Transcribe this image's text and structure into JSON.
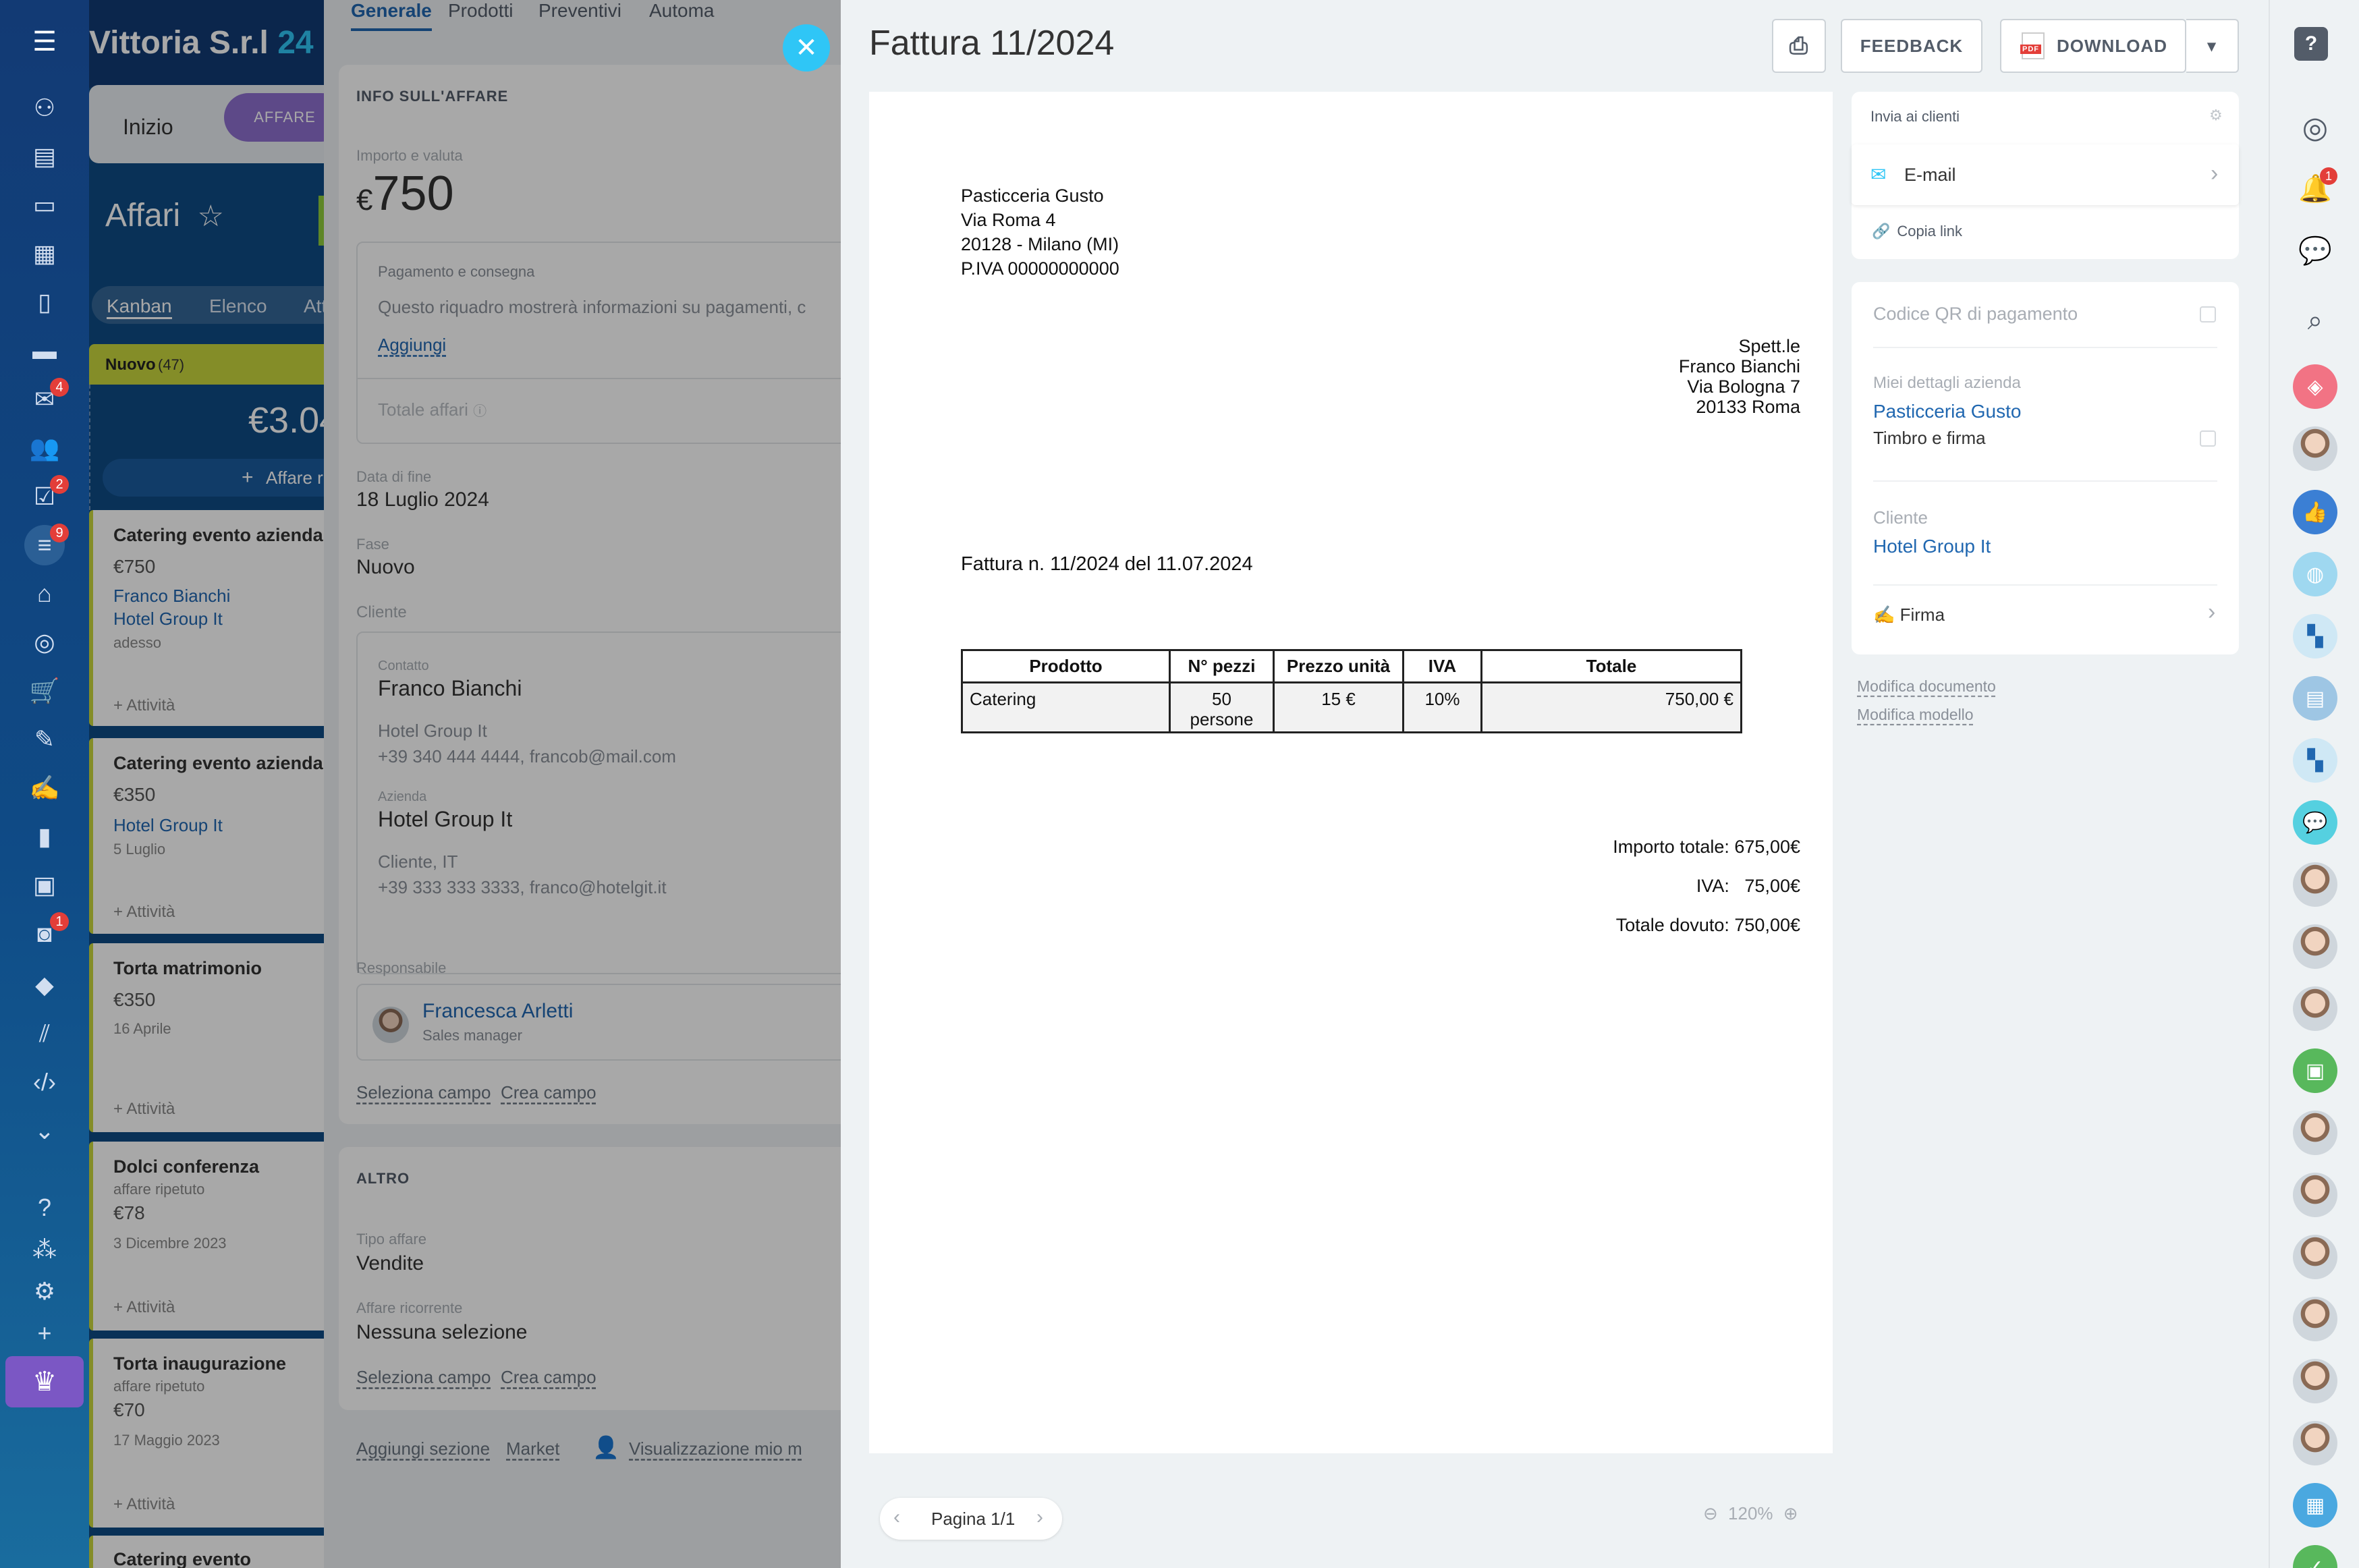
{
  "left_nav": {
    "badges": {
      "mail": "4",
      "tasks": "2",
      "filters": "9",
      "robots": "1"
    }
  },
  "crm": {
    "company_title": "Vittoria S.r.l",
    "company_suffix": "24",
    "stage_tabs": {
      "start": "Inizio",
      "deal_badge": "AFFARE"
    },
    "page_title": "Affari",
    "view_tabs": [
      "Kanban",
      "Elenco",
      "Att"
    ],
    "column": {
      "name": "Nuovo",
      "count": "(47)",
      "total": "€3.04",
      "add_button": "Affare r"
    },
    "deal_cards": [
      {
        "title": "Catering evento aziendale",
        "amount": "€750",
        "contact": "Franco Bianchi",
        "company": "Hotel Group It",
        "date": "adesso",
        "activity": "+ Attività"
      },
      {
        "title": "Catering evento aziendale",
        "amount": "€350",
        "contact": "",
        "company": "Hotel Group It",
        "date": "5 Luglio",
        "activity": "+ Attività"
      },
      {
        "title": "Torta matrimonio",
        "amount": "€350",
        "date": "16 Aprile",
        "activity": "+ Attività"
      },
      {
        "title": "Dolci conferenza",
        "subtitle": "affare ripetuto",
        "amount": "€78",
        "date": "3 Dicembre 2023",
        "activity": "+ Attività"
      },
      {
        "title": "Torta inaugurazione",
        "subtitle": "affare ripetuto",
        "amount": "€70",
        "date": "17 Maggio 2023",
        "activity": "+ Attività"
      },
      {
        "title": "Catering evento"
      }
    ],
    "deal_tabs": [
      "Generale",
      "Prodotti",
      "Preventivi",
      "Automa"
    ],
    "info_section": {
      "title": "INFO SULL'AFFARE",
      "amount_label": "Importo e valuta",
      "currency": "€",
      "amount": "750",
      "payment_label": "Pagamento e consegna",
      "payment_text": "Questo riquadro mostrerà informazioni su pagamenti, c",
      "add_link": "Aggiungi",
      "total_label": "Totale affari",
      "end_date_label": "Data di fine",
      "end_date": "18 Luglio 2024",
      "stage_label": "Fase",
      "stage": "Nuovo",
      "client_label": "Cliente",
      "contact_label": "Contatto",
      "contact_name": "Franco Bianchi",
      "contact_company": "Hotel Group It",
      "contact_details": "+39 340 444 4444, francob@mail.com",
      "company_label": "Azienda",
      "company_name": "Hotel Group It",
      "company_type": "Cliente, IT",
      "company_details": "+39 333 333 3333, franco@hotelgit.it",
      "responsible_label": "Responsabile",
      "responsible_name": "Francesca Arletti",
      "responsible_role": "Sales manager",
      "select_field": "Seleziona campo",
      "create_field": "Crea campo"
    },
    "other_section": {
      "title": "ALTRO",
      "type_label": "Tipo affare",
      "type_value": "Vendite",
      "recurring_label": "Affare ricorrente",
      "recurring_value": "Nessuna selezione",
      "select_field": "Seleziona campo",
      "create_field": "Crea campo"
    },
    "footer_links": [
      "Aggiungi sezione",
      "Market",
      "Visualizzazione mio m"
    ]
  },
  "slider": {
    "title": "Fattura 11/2024",
    "feedback_label": "FEEDBACK",
    "download_label": "DOWNLOAD",
    "document": {
      "sender": [
        "Pasticceria Gusto",
        "Via Roma 4",
        "20128 - Milano (MI)",
        "P.IVA 00000000000"
      ],
      "recipient": [
        "Spett.le",
        "Franco Bianchi",
        "Via Bologna 7",
        "20133 Roma"
      ],
      "invoice_line": "Fattura n. 11/2024 del 11.07.2024",
      "table_headers": [
        "Prodotto",
        "N° pezzi",
        "Prezzo unità",
        "IVA",
        "Totale"
      ],
      "table_rows": [
        [
          "Catering",
          "50 persone",
          "15 €",
          "10%",
          "750,00 €"
        ]
      ],
      "totals": {
        "import_label": "Importo totale:",
        "import_value": "675,00€",
        "iva_label": "IVA:",
        "iva_value": "75,00€",
        "due_label": "Totale dovuto:",
        "due_value": "750,00€"
      }
    },
    "pager": {
      "label": "Pagina 1/1",
      "zoom": "120%"
    },
    "send_card": {
      "title": "Invia ai clienti",
      "email_label": "E-mail",
      "copy_link": "Copia link"
    },
    "settings_card": {
      "qr_label": "Codice QR di pagamento",
      "company_details_label": "Miei dettagli azienda",
      "company_name": "Pasticceria Gusto",
      "stamp_label": "Timbro e firma",
      "client_label": "Cliente",
      "client_name": "Hotel Group It",
      "signature_label": "Firma"
    },
    "edit_links": {
      "document": "Modifica documento",
      "template": "Modifica modello"
    }
  },
  "right_bar": {
    "notification_badge": "1"
  },
  "colors": {
    "accent": "#2fc6f6",
    "link": "#2067b0",
    "nav": "#123a74",
    "badge": "#e33e39",
    "crown": "#7b57c4"
  }
}
